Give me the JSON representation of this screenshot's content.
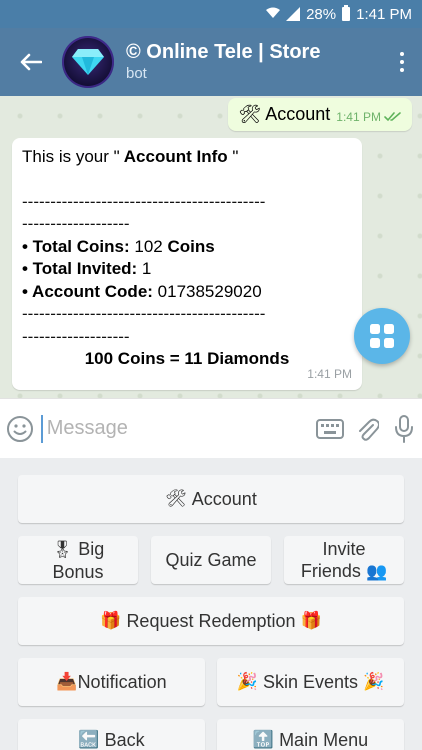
{
  "status_bar": {
    "battery": "28%",
    "time": "1:41 PM"
  },
  "header": {
    "title": "© Online Tele | Store",
    "subtitle": "bot"
  },
  "messages": {
    "outgoing": {
      "emoji": "🛠",
      "text": "Account",
      "time": "1:41 PM"
    },
    "incoming": {
      "line_intro_pre": "This is your \"",
      "line_intro_bold": " Account Info ",
      "line_intro_post": "\"",
      "dashes_1": "-------------------------------------------",
      "dashes_2": "-------------------",
      "coins_label": "• Total Coins:",
      "coins_value": " 102 ",
      "coins_unit": "Coins",
      "invited_label": "• Total Invited:",
      "invited_value": " 1",
      "code_label": "• Account Code:",
      "code_value": " 01738529020",
      "dashes_3": "-------------------------------------------",
      "dashes_4": "-------------------",
      "rate": "100 Coins = 11 Diamonds",
      "time": "1:41 PM"
    }
  },
  "input": {
    "placeholder": "Message"
  },
  "keyboard": {
    "account": {
      "emoji": "🛠",
      "label": "Account"
    },
    "big_bonus": {
      "emoji": "🎖",
      "label_1": "Big",
      "label_2": "Bonus"
    },
    "quiz": {
      "label": "Quiz Game"
    },
    "invite": {
      "label_1": "Invite",
      "label_2": "Friends",
      "emoji": "👥"
    },
    "redemption": {
      "emoji_left": "🎁",
      "label": "Request Redemption",
      "emoji_right": "🎁"
    },
    "notification": {
      "emoji": "📥",
      "label": "Notification"
    },
    "skin_events": {
      "emoji_left": "🎉",
      "label": "Skin Events",
      "emoji_right": "🎉"
    },
    "back": {
      "emoji": "🔙",
      "label": "Back"
    },
    "main_menu": {
      "emoji": "🔝",
      "label": "Main Menu"
    }
  },
  "colors": {
    "header": "#527da3",
    "status_bar": "#4a7ea8",
    "fab": "#5bb6e8",
    "outgoing_bubble": "#effdde"
  }
}
